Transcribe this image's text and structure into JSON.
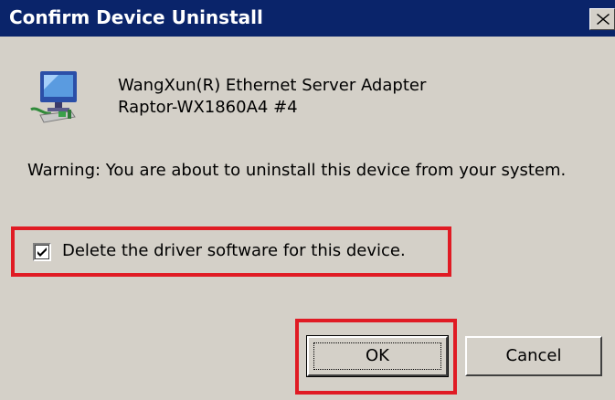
{
  "window": {
    "title": "Confirm Device Uninstall",
    "close_symbol": "×"
  },
  "device": {
    "icon": "network-adapter-icon",
    "name_line1": "WangXun(R) Ethernet Server Adapter",
    "name_line2": "Raptor-WX1860A4 #4"
  },
  "warning_text": "Warning: You are about to uninstall this device from your system.",
  "delete_driver": {
    "label": "Delete the driver software for this device.",
    "checked": true
  },
  "buttons": {
    "ok_label": "OK",
    "cancel_label": "Cancel"
  },
  "colors": {
    "titlebar": "#0a246a",
    "dialog_background": "#d4d0c8",
    "highlight": "#e01b24"
  }
}
